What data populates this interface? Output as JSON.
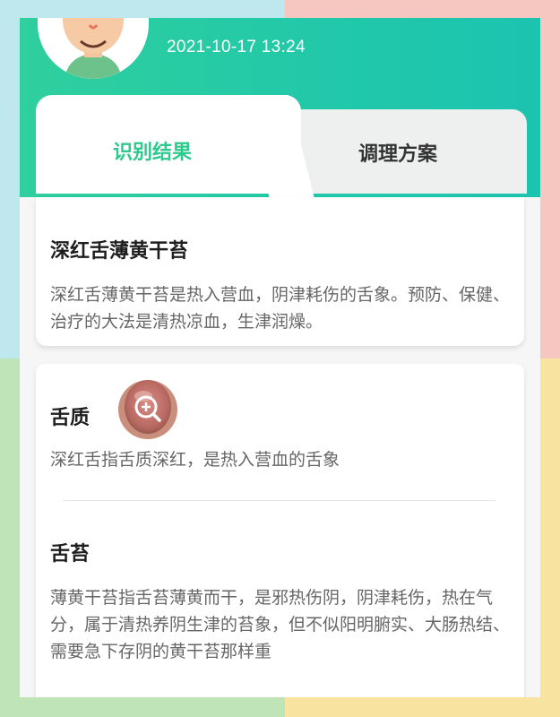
{
  "header": {
    "datetime": "2021-10-17 13:24",
    "gradient_color": "#2fcf9e"
  },
  "tabs": [
    {
      "label": "识别结果",
      "active": true,
      "color": "#2ec98d"
    },
    {
      "label": "调理方案",
      "active": false,
      "color": "#333333"
    }
  ],
  "summary": {
    "title": "深红舌薄黄干苔",
    "description": "深红舌薄黄干苔是热入营血，阴津耗伤的舌象。预防、保健、治疗的大法是清热凉血，生津润燥。"
  },
  "tongue_body": {
    "title": "舌质",
    "thumbnail_icon": "zoom-in-icon",
    "description": "深红舌指舌质深红，是热入营血的舌象"
  },
  "tongue_coating": {
    "title": "舌苔",
    "description": "薄黄干苔指舌苔薄黄而干，是邪热伤阴，阴津耗伤，热在气分，属于清热养阴生津的苔象，但不似阳明腑实、大肠热结、需要急下存阴的黄干苔那样重"
  }
}
